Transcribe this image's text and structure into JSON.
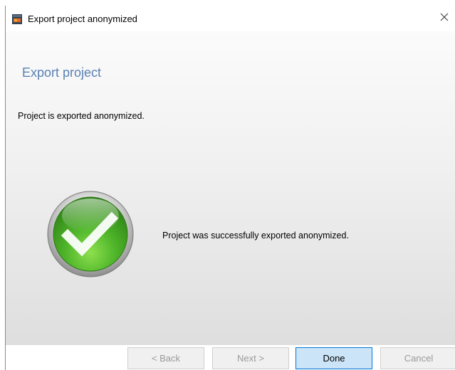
{
  "window": {
    "title": "Export project anonymized",
    "icon": "project-export-icon",
    "close_icon": "close-icon"
  },
  "main": {
    "heading": "Export project",
    "subtext": "Project is exported anonymized.",
    "status_icon": "success-checkmark-icon",
    "success_message": "Project was successfully exported anonymized."
  },
  "footer": {
    "back_label": "< Back",
    "next_label": "Next >",
    "done_label": "Done",
    "cancel_label": "Cancel"
  },
  "colors": {
    "heading": "#5a82b4",
    "done_button_border": "#0078d7",
    "done_button_fill": "#cce4f7",
    "success_green": "#4caf26"
  }
}
